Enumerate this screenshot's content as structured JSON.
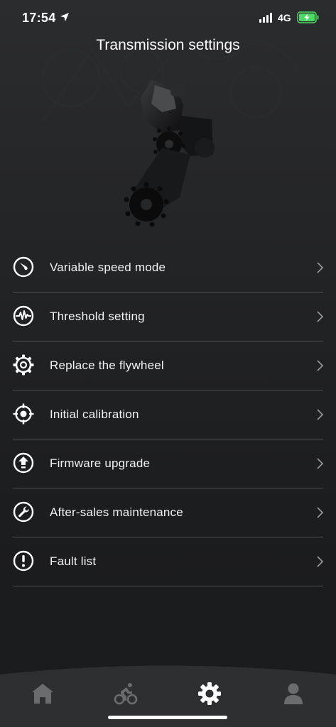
{
  "status_bar": {
    "time": "17:54",
    "network": "4G",
    "location_icon": "location-arrow-icon",
    "signal_icon": "signal-bars-icon",
    "battery_icon": "battery-charging-icon",
    "battery_color": "#4cd964"
  },
  "header": {
    "title": "Transmission settings",
    "image": "rear-derailleur-image"
  },
  "menu": {
    "items": [
      {
        "label": "Variable speed mode",
        "icon": "speedometer-icon"
      },
      {
        "label": "Threshold setting",
        "icon": "waveform-icon"
      },
      {
        "label": "Replace the flywheel",
        "icon": "gear-sprocket-icon"
      },
      {
        "label": "Initial calibration",
        "icon": "crosshair-icon"
      },
      {
        "label": "Firmware upgrade",
        "icon": "upgrade-arrow-icon"
      },
      {
        "label": "After-sales maintenance",
        "icon": "wrench-icon"
      },
      {
        "label": "Fault list",
        "icon": "alert-icon"
      }
    ]
  },
  "tabbar": {
    "tabs": [
      {
        "name": "home",
        "icon": "home-icon",
        "active": false
      },
      {
        "name": "ride",
        "icon": "cyclist-icon",
        "active": false
      },
      {
        "name": "settings",
        "icon": "gear-icon",
        "active": true
      },
      {
        "name": "profile",
        "icon": "user-icon",
        "active": false
      }
    ],
    "active_color": "#ffffff",
    "inactive_color": "#6b6c6e",
    "background": "#2e2f31"
  }
}
